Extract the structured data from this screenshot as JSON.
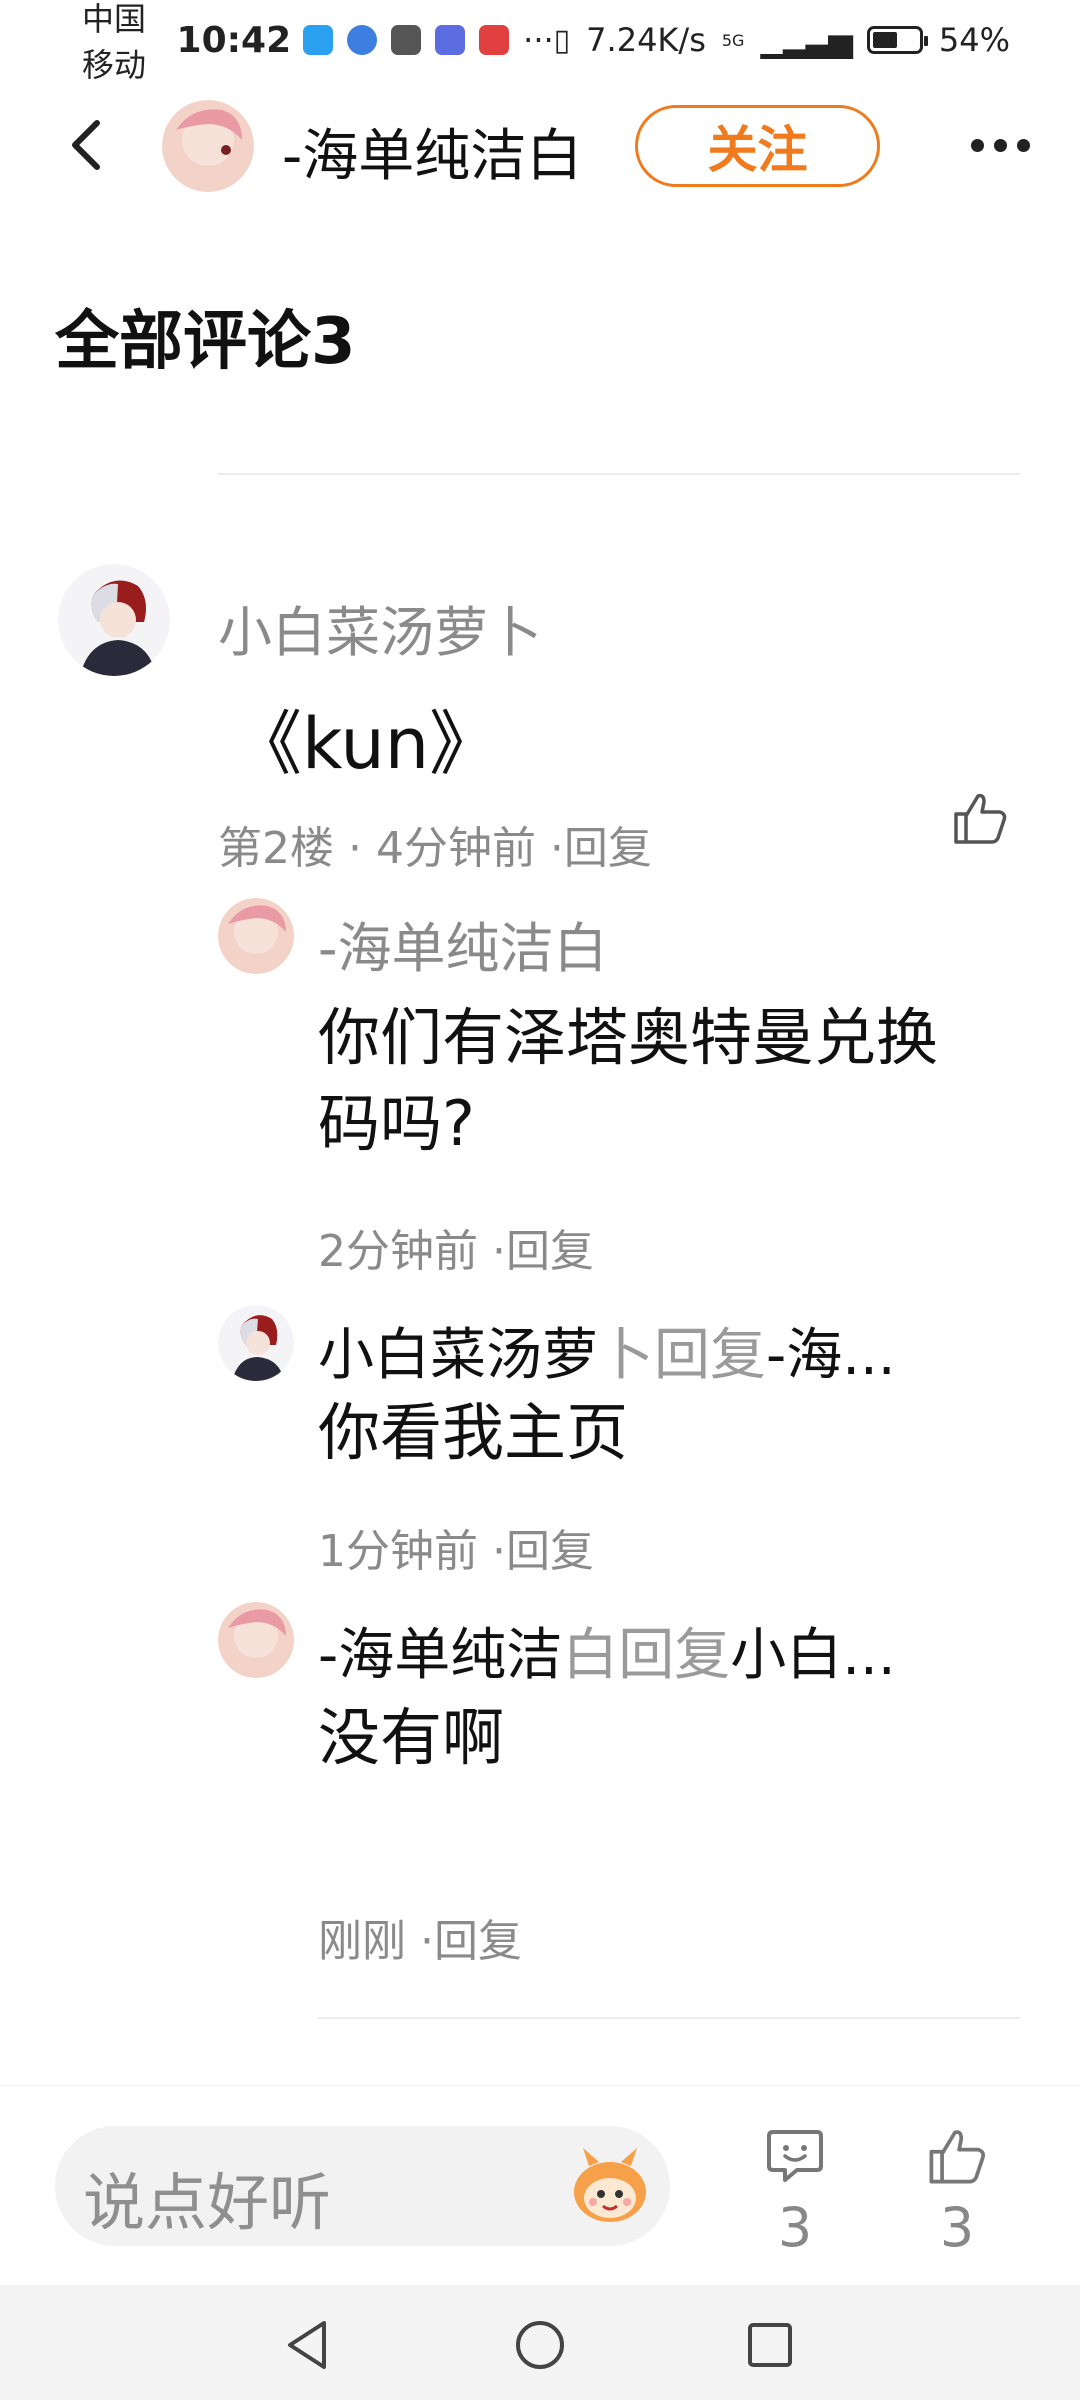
{
  "status_bar": {
    "carrier": "中国移动",
    "time": "10:42",
    "ellipsis": "···",
    "net_speed": "7.24K/s",
    "signal": "5G",
    "battery_pct": "54%",
    "battery_level": 0.54
  },
  "header": {
    "author_name": "-海单纯洁白",
    "follow_label": "关注"
  },
  "section_title": "全部评论3",
  "comment": {
    "author": "小白菜汤萝卜",
    "text": "《kun》",
    "meta": "第2楼 · 4分钟前 ·回复"
  },
  "replies": [
    {
      "author": "-海单纯洁白",
      "text": "你们有泽塔奥特曼兑换码吗?",
      "meta": "2分钟前 ·回复"
    },
    {
      "author": "小白菜汤萝",
      "author_faded": "卜",
      "reply_word": "回复",
      "target": "-海...",
      "text": "你看我主页",
      "meta": "1分钟前 ·回复"
    },
    {
      "author": "-海单纯洁",
      "author_faded": "白",
      "reply_word": "回复",
      "target": "小白...",
      "text": "没有啊",
      "meta": "刚刚 ·回复"
    }
  ],
  "bottom_bar": {
    "input_placeholder": "说点好听",
    "comment_count": "3",
    "like_count": "3"
  },
  "colors": {
    "accent": "#f07a1e",
    "muted_text": "#8a8a8a"
  },
  "icons": [
    "back-arrow-icon",
    "more-icon",
    "thumbs-up-icon",
    "comment-icon",
    "mascot-icon",
    "nav-back-icon",
    "nav-home-icon",
    "nav-recents-icon"
  ]
}
